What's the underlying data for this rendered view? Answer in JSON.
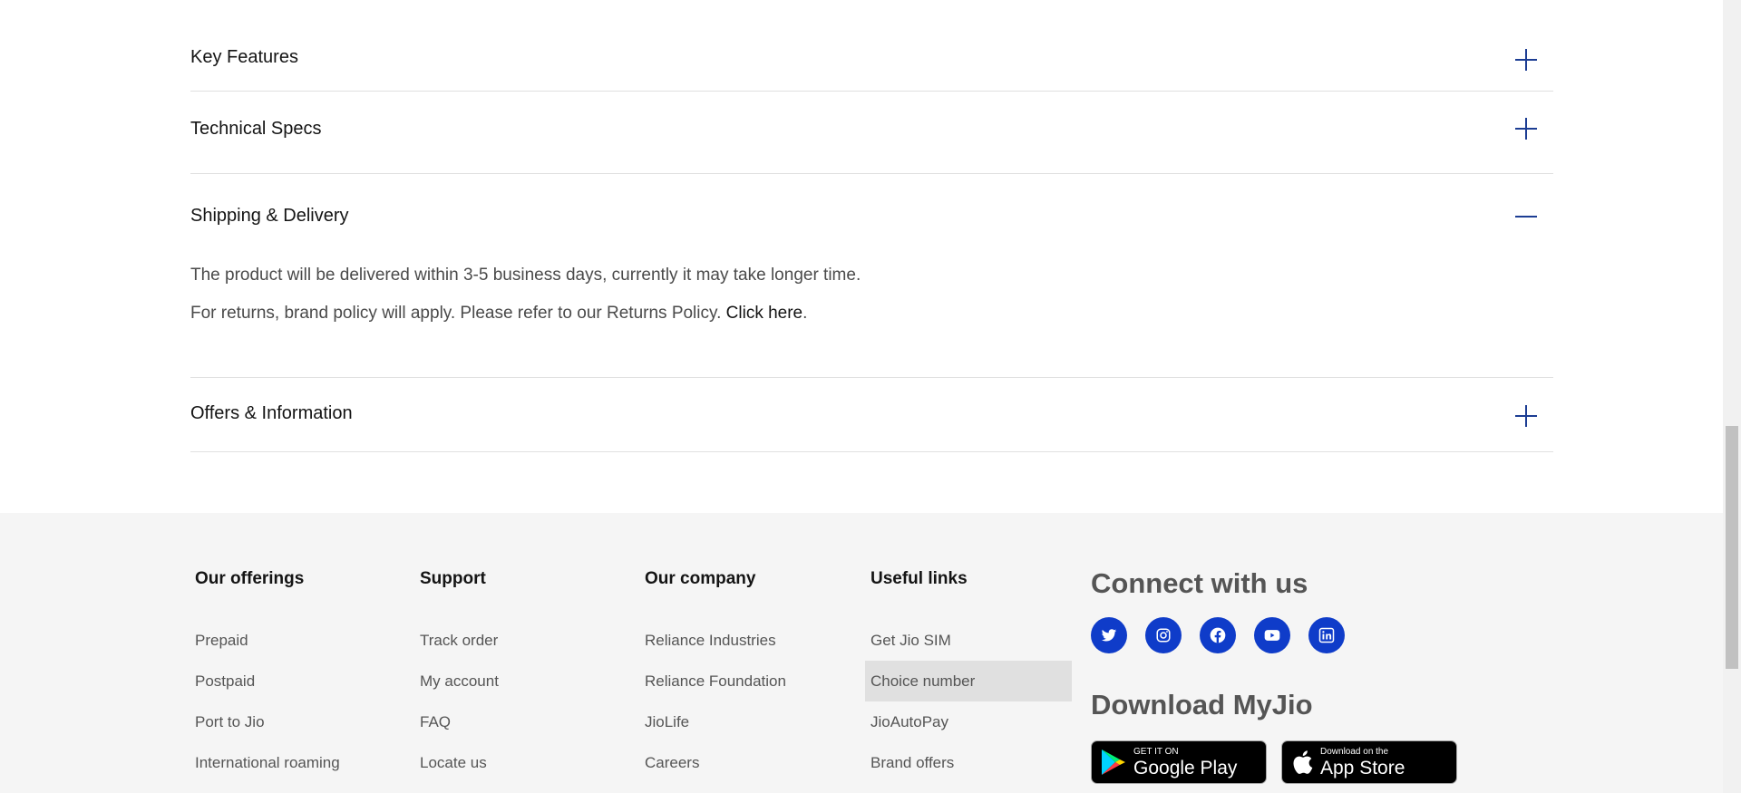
{
  "accordion": {
    "items": [
      {
        "title": "Key Features",
        "icon": "plus-icon"
      },
      {
        "title": "Technical Specs",
        "icon": "plus-icon"
      },
      {
        "title": "Shipping & Delivery",
        "icon": "minus-icon",
        "line1": "The product will be delivered within 3-5 business days, currently it may take longer time.",
        "line2_prefix": "For returns, brand policy will apply. Please refer to our Returns Policy. ",
        "line2_link": "Click here",
        "line2_suffix": "."
      },
      {
        "title": "Offers & Information",
        "icon": "plus-icon"
      }
    ]
  },
  "footer": {
    "columns": [
      {
        "heading": "Our offerings",
        "links": [
          "Prepaid",
          "Postpaid",
          "Port to Jio",
          "International roaming"
        ]
      },
      {
        "heading": "Support",
        "links": [
          "Track order",
          "My account",
          "FAQ",
          "Locate us"
        ]
      },
      {
        "heading": "Our company",
        "links": [
          "Reliance Industries",
          "Reliance Foundation",
          "JioLife",
          "Careers"
        ]
      },
      {
        "heading": "Useful links",
        "links": [
          "Get Jio SIM",
          "Choice number",
          "JioAutoPay",
          "Brand offers"
        ]
      }
    ],
    "connect_title": "Connect with us",
    "socials": [
      "twitter-icon",
      "instagram-icon",
      "facebook-icon",
      "youtube-icon",
      "linkedin-icon"
    ],
    "download_title": "Download MyJio",
    "google_play": {
      "small": "GET IT ON",
      "big": "Google Play"
    },
    "app_store": {
      "small": "Download on the",
      "big": "App Store"
    },
    "social_color": "#0f3cc9",
    "accent_color": "#1c3d93"
  }
}
